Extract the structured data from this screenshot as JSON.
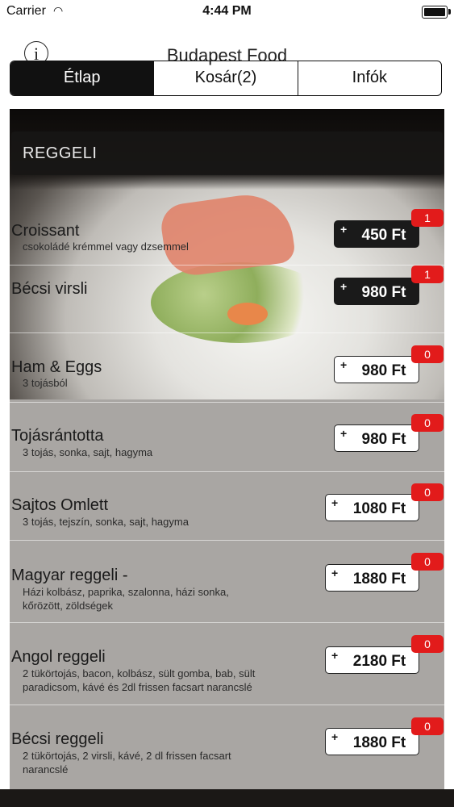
{
  "status": {
    "carrier": "Carrier",
    "time": "4:44 PM"
  },
  "nav": {
    "title": "Budapest Food",
    "info_label": "i"
  },
  "tabs": [
    {
      "label": "Étlap",
      "selected": true
    },
    {
      "label": "Kosár(2)",
      "selected": false
    },
    {
      "label": "Infók",
      "selected": false
    }
  ],
  "section": {
    "title": "REGGELI"
  },
  "items": [
    {
      "name": "Croissant",
      "desc": "csokoládé krémmel vagy dzsemmel",
      "price": "450 Ft",
      "count": "1",
      "selected": true
    },
    {
      "name": "Bécsi virsli",
      "desc": "",
      "price": "980 Ft",
      "count": "1",
      "selected": true
    },
    {
      "name": "Ham & Eggs",
      "desc": "3 tojásból",
      "price": "980 Ft",
      "count": "0",
      "selected": false
    },
    {
      "name": "Tojásrántotta",
      "desc": "3 tojás, sonka, sajt, hagyma",
      "price": "980 Ft",
      "count": "0",
      "selected": false
    },
    {
      "name": "Sajtos Omlett",
      "desc": "3 tojás, tejszín, sonka, sajt, hagyma",
      "price": "1080 Ft",
      "count": "0",
      "selected": false
    },
    {
      "name": "Magyar reggeli -",
      "desc": "Házi kolbász, paprika, szalonna, házi sonka, kőrözött, zöldségek",
      "price": "1880 Ft",
      "count": "0",
      "selected": false
    },
    {
      "name": "Angol reggeli",
      "desc": "2 tükörtojás, bacon, kolbász, sült gomba, bab, sült paradicsom, kávé és 2dl frissen facsart narancslé",
      "price": "2180 Ft",
      "count": "0",
      "selected": false
    },
    {
      "name": "Bécsi reggeli",
      "desc": "2 tükörtojás, 2 virsli, kávé, 2 dl frissen facsart narancslé",
      "price": "1880 Ft",
      "count": "0",
      "selected": false
    }
  ],
  "plus_symbol": "+",
  "colors": {
    "badge": "#e21b1b",
    "selected_price_bg": "#1a1a1a",
    "list_bg": "#a9a6a3"
  }
}
